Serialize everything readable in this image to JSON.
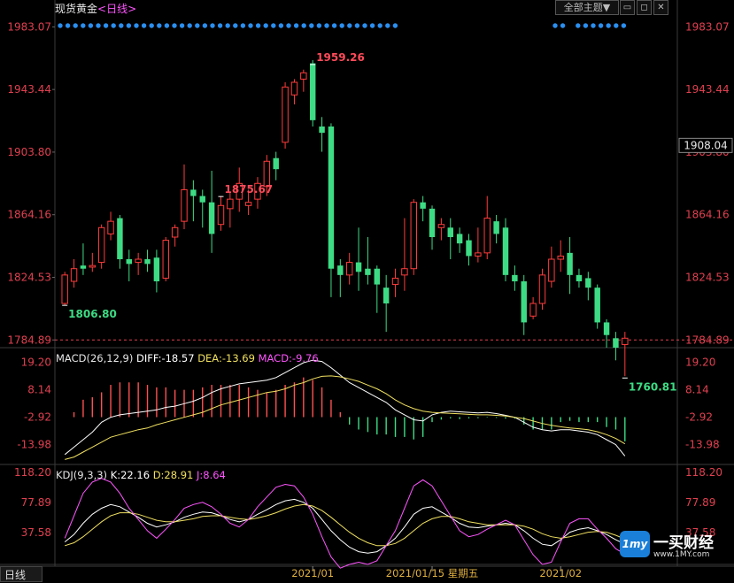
{
  "header": {
    "symbol": "现货黄金",
    "period": "<日线>",
    "theme_button": "全部主题▼",
    "close_icon": "close-icon"
  },
  "footer": {
    "period_tab": "日线"
  },
  "logo": {
    "text": "一买财经",
    "url": "www.1MY.com",
    "mark": "1my"
  },
  "chart_data": [
    {
      "type": "candlestick",
      "title": "现货黄金",
      "ylim": [
        1780,
        1990
      ],
      "y_ticks": [
        "1983.07",
        "1943.44",
        "1903.80",
        "1864.16",
        "1824.53",
        "1784.89"
      ],
      "current_price_label": "1908.04",
      "reference_line": 1784.89,
      "annotations": [
        {
          "text": "1959.26",
          "value": 1959.26,
          "type": "high"
        },
        {
          "text": "1875.67",
          "value": 1875.67,
          "type": "high"
        },
        {
          "text": "1806.80",
          "value": 1806.8,
          "type": "low"
        },
        {
          "text": "1760.81",
          "value": 1760.81,
          "type": "low"
        }
      ],
      "x_labels": [
        "2021/01",
        "2021/01/15 星期五",
        "2021/02"
      ],
      "x_label_index": [
        27,
        40,
        54
      ],
      "candles": [
        [
          1808,
          1826,
          1807,
          1828
        ],
        [
          1822,
          1830,
          1818,
          1836
        ],
        [
          1832,
          1830,
          1826,
          1846
        ],
        [
          1831,
          1832,
          1828,
          1840
        ],
        [
          1834,
          1856,
          1830,
          1858
        ],
        [
          1852,
          1860,
          1848,
          1866
        ],
        [
          1862,
          1836,
          1830,
          1864
        ],
        [
          1836,
          1833,
          1822,
          1842
        ],
        [
          1834,
          1836,
          1826,
          1840
        ],
        [
          1836,
          1833,
          1828,
          1842
        ],
        [
          1837,
          1822,
          1815,
          1842
        ],
        [
          1824,
          1848,
          1822,
          1850
        ],
        [
          1850,
          1856,
          1844,
          1858
        ],
        [
          1860,
          1880,
          1855,
          1896
        ],
        [
          1880,
          1876,
          1860,
          1886
        ],
        [
          1876,
          1872,
          1856,
          1880
        ],
        [
          1872,
          1852,
          1840,
          1892
        ],
        [
          1858,
          1870,
          1854,
          1876
        ],
        [
          1868,
          1874,
          1856,
          1878
        ],
        [
          1874,
          1884,
          1866,
          1894
        ],
        [
          1870,
          1872,
          1864,
          1880
        ],
        [
          1874,
          1884,
          1868,
          1888
        ],
        [
          1882,
          1898,
          1876,
          1902
        ],
        [
          1900,
          1893,
          1886,
          1904
        ],
        [
          1910,
          1945,
          1906,
          1948
        ],
        [
          1940,
          1948,
          1934,
          1950
        ],
        [
          1950,
          1954,
          1942,
          1956
        ],
        [
          1960,
          1924,
          1920,
          1962
        ],
        [
          1920,
          1916,
          1904,
          1926
        ],
        [
          1920,
          1830,
          1812,
          1922
        ],
        [
          1832,
          1826,
          1812,
          1836
        ],
        [
          1826,
          1834,
          1820,
          1840
        ],
        [
          1834,
          1828,
          1816,
          1856
        ],
        [
          1830,
          1826,
          1820,
          1850
        ],
        [
          1830,
          1820,
          1802,
          1832
        ],
        [
          1818,
          1808,
          1790,
          1826
        ],
        [
          1820,
          1824,
          1812,
          1830
        ],
        [
          1826,
          1830,
          1816,
          1862
        ],
        [
          1830,
          1872,
          1826,
          1874
        ],
        [
          1872,
          1868,
          1860,
          1876
        ],
        [
          1868,
          1850,
          1842,
          1870
        ],
        [
          1856,
          1858,
          1848,
          1862
        ],
        [
          1856,
          1850,
          1836,
          1862
        ],
        [
          1852,
          1846,
          1840,
          1856
        ],
        [
          1848,
          1838,
          1832,
          1852
        ],
        [
          1838,
          1840,
          1834,
          1856
        ],
        [
          1840,
          1862,
          1836,
          1876
        ],
        [
          1860,
          1852,
          1846,
          1864
        ],
        [
          1856,
          1826,
          1822,
          1862
        ],
        [
          1826,
          1822,
          1816,
          1832
        ],
        [
          1822,
          1796,
          1788,
          1826
        ],
        [
          1800,
          1808,
          1798,
          1812
        ],
        [
          1808,
          1826,
          1804,
          1830
        ],
        [
          1822,
          1836,
          1818,
          1844
        ],
        [
          1836,
          1838,
          1828,
          1848
        ],
        [
          1840,
          1826,
          1814,
          1850
        ],
        [
          1826,
          1822,
          1818,
          1830
        ],
        [
          1824,
          1818,
          1810,
          1828
        ],
        [
          1818,
          1796,
          1792,
          1820
        ],
        [
          1796,
          1788,
          1780,
          1798
        ],
        [
          1786,
          1780,
          1772,
          1790
        ],
        [
          1782,
          1786,
          1762,
          1790
        ]
      ]
    },
    {
      "type": "bar-line",
      "title": "MACD(26,12,9)",
      "labels": [
        {
          "text": "MACD(26,12,9)",
          "color": "#e6e6e6"
        },
        {
          "text": "DIFF:-18.57",
          "color": "#ffffff"
        },
        {
          "text": "DEA:-13.69",
          "color": "#f0e060"
        },
        {
          "text": "MACD:-9.76",
          "color": "#ff55ff"
        }
      ],
      "ylim": [
        -22,
        24
      ],
      "y_ticks": [
        "19.20",
        "8.14",
        "-2.92",
        "-13.98"
      ],
      "series": [
        {
          "name": "DIFF",
          "color": "#ffffff",
          "values": [
            -18,
            -15,
            -12,
            -9,
            -5,
            -3,
            -2,
            -1.5,
            -1,
            -0.5,
            0,
            1,
            1.5,
            2.5,
            3.5,
            5,
            7,
            8.5,
            9.5,
            10.5,
            11,
            11.5,
            12,
            13,
            15,
            17,
            19,
            20,
            19.5,
            17,
            14,
            11,
            9,
            7,
            5,
            3,
            0,
            -2,
            -4,
            -4.5,
            -2,
            -1,
            -0.5,
            -0.8,
            -1,
            -1.2,
            -1,
            -1.5,
            -2.2,
            -3,
            -5,
            -7,
            -8,
            -8.5,
            -8,
            -8,
            -8.5,
            -9,
            -10,
            -12,
            -14,
            -18.57
          ]
        },
        {
          "name": "DEA",
          "color": "#f0e060",
          "values": [
            -20,
            -19,
            -17,
            -15,
            -13,
            -11,
            -10,
            -9,
            -8,
            -7.3,
            -6,
            -5,
            -4,
            -3,
            -2,
            -1,
            0.5,
            2,
            3,
            4,
            5,
            6,
            7,
            7.5,
            8.5,
            10,
            11,
            12.5,
            13.5,
            13.7,
            13.3,
            12.5,
            11.5,
            10,
            8.5,
            6.5,
            4,
            2,
            0.5,
            -0.5,
            -1,
            -1.2,
            -1.4,
            -1.6,
            -1.8,
            -2,
            -2,
            -2.2,
            -2.5,
            -3,
            -3.5,
            -4.5,
            -5.5,
            -6.2,
            -6.8,
            -7.3,
            -7.6,
            -8,
            -8.8,
            -10,
            -11.5,
            -13.69
          ]
        },
        {
          "name": "MACD",
          "color": "#ff5050",
          "values": [
            0,
            2,
            7,
            8,
            10,
            13,
            14,
            14,
            14,
            13,
            12,
            12,
            11,
            11,
            11,
            12,
            13,
            13,
            13,
            13,
            12,
            11,
            10,
            11,
            13,
            14,
            16,
            15,
            12,
            7,
            2,
            -3,
            -5,
            -6,
            -7,
            -7,
            -8,
            -8,
            -9,
            -8,
            -2,
            -1,
            -0.5,
            -0.8,
            -0.5,
            -0.4,
            -0.2,
            -0.3,
            -0.6,
            -0.6,
            -3,
            -5,
            -5,
            -5,
            -2,
            -1.5,
            -2,
            -2,
            -2,
            -4,
            -5,
            -9.76
          ]
        }
      ]
    },
    {
      "type": "line",
      "title": "KDJ(9,3,3)",
      "labels": [
        {
          "text": "KDJ(9,3,3)",
          "color": "#e6e6e6"
        },
        {
          "text": "K:22.16",
          "color": "#ffffff"
        },
        {
          "text": "D:28.91",
          "color": "#f0e060"
        },
        {
          "text": "J:8.64",
          "color": "#ff55ff"
        }
      ],
      "ylim": [
        -5,
        125
      ],
      "y_ticks": [
        "118.20",
        "77.89",
        "37.58"
      ],
      "series": [
        {
          "name": "K",
          "color": "#ffffff",
          "values": [
            25,
            35,
            50,
            62,
            70,
            75,
            72,
            65,
            58,
            50,
            45,
            48,
            52,
            58,
            62,
            65,
            64,
            60,
            55,
            52,
            55,
            62,
            68,
            75,
            80,
            82,
            78,
            70,
            55,
            40,
            28,
            18,
            12,
            10,
            12,
            20,
            30,
            45,
            62,
            70,
            72,
            65,
            58,
            50,
            45,
            44,
            46,
            48,
            50,
            48,
            40,
            30,
            22,
            20,
            28,
            38,
            42,
            44,
            40,
            35,
            28,
            22.16
          ]
        },
        {
          "name": "D",
          "color": "#f0e060",
          "values": [
            20,
            24,
            32,
            42,
            52,
            60,
            64,
            64,
            62,
            58,
            54,
            52,
            52,
            54,
            56,
            59,
            60,
            60,
            58,
            56,
            55,
            57,
            60,
            64,
            69,
            73,
            75,
            73,
            67,
            58,
            48,
            38,
            30,
            24,
            20,
            20,
            23,
            30,
            40,
            50,
            56,
            59,
            59,
            56,
            52,
            50,
            48,
            48,
            48,
            48,
            46,
            42,
            36,
            32,
            30,
            32,
            35,
            38,
            39,
            38,
            34,
            28.91
          ]
        },
        {
          "name": "J",
          "color": "#ff55ff",
          "values": [
            30,
            60,
            90,
            105,
            110,
            105,
            90,
            70,
            55,
            40,
            30,
            42,
            55,
            70,
            75,
            78,
            72,
            62,
            50,
            45,
            55,
            72,
            85,
            98,
            102,
            100,
            85,
            62,
            32,
            5,
            -10,
            -5,
            -2,
            -5,
            0,
            20,
            40,
            70,
            100,
            108,
            100,
            80,
            60,
            40,
            32,
            35,
            42,
            48,
            54,
            48,
            28,
            8,
            -5,
            -2,
            25,
            50,
            56,
            56,
            42,
            30,
            16,
            8.64
          ]
        }
      ]
    }
  ]
}
